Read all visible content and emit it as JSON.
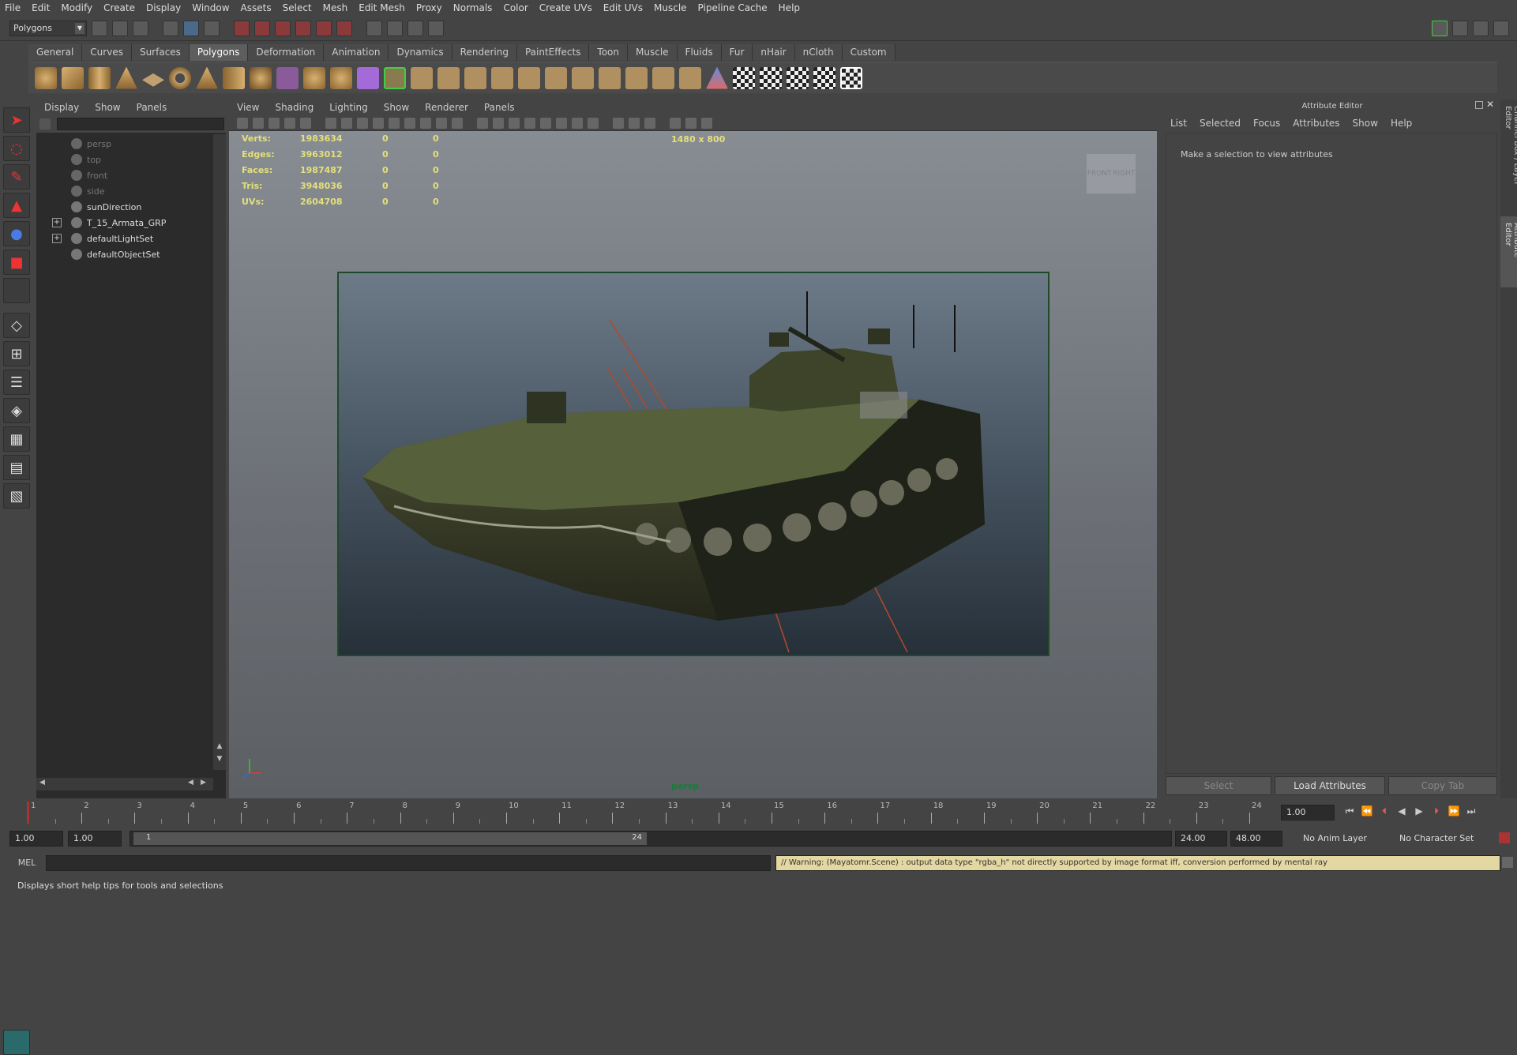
{
  "menubar": [
    "File",
    "Edit",
    "Modify",
    "Create",
    "Display",
    "Window",
    "Assets",
    "Select",
    "Mesh",
    "Edit Mesh",
    "Proxy",
    "Normals",
    "Color",
    "Create UVs",
    "Edit UVs",
    "Muscle",
    "Pipeline Cache",
    "Help"
  ],
  "status_line": {
    "mode_dropdown": "Polygons"
  },
  "shelf_tabs": [
    "General",
    "Curves",
    "Surfaces",
    "Polygons",
    "Deformation",
    "Animation",
    "Dynamics",
    "Rendering",
    "PaintEffects",
    "Toon",
    "Muscle",
    "Fluids",
    "Fur",
    "nHair",
    "nCloth",
    "Custom"
  ],
  "shelf_active": "Polygons",
  "outliner": {
    "menu": [
      "Display",
      "Show",
      "Panels"
    ],
    "items": [
      {
        "label": "persp",
        "dim": true,
        "expandable": false
      },
      {
        "label": "top",
        "dim": true,
        "expandable": false
      },
      {
        "label": "front",
        "dim": true,
        "expandable": false
      },
      {
        "label": "side",
        "dim": true,
        "expandable": false
      },
      {
        "label": "sunDirection",
        "dim": false,
        "expandable": false
      },
      {
        "label": "T_15_Armata_GRP",
        "dim": false,
        "expandable": true
      },
      {
        "label": "defaultLightSet",
        "dim": false,
        "expandable": true
      },
      {
        "label": "defaultObjectSet",
        "dim": false,
        "expandable": false
      }
    ]
  },
  "viewport": {
    "menu": [
      "View",
      "Shading",
      "Lighting",
      "Show",
      "Renderer",
      "Panels"
    ],
    "resolution": "1480 x 800",
    "camera": "persp",
    "viewcube_faces": [
      "FRONT",
      "RIGHT"
    ],
    "hud": [
      {
        "label": "Verts:",
        "v1": "1983634",
        "v2": "0",
        "v3": "0"
      },
      {
        "label": "Edges:",
        "v1": "3963012",
        "v2": "0",
        "v3": "0"
      },
      {
        "label": "Faces:",
        "v1": "1987487",
        "v2": "0",
        "v3": "0"
      },
      {
        "label": "Tris:",
        "v1": "3948036",
        "v2": "0",
        "v3": "0"
      },
      {
        "label": "UVs:",
        "v1": "2604708",
        "v2": "0",
        "v3": "0"
      }
    ]
  },
  "attribute_editor": {
    "title": "Attribute Editor",
    "menu": [
      "List",
      "Selected",
      "Focus",
      "Attributes",
      "Show",
      "Help"
    ],
    "message": "Make a selection to view attributes",
    "buttons": {
      "select": "Select",
      "load": "Load Attributes",
      "copy": "Copy Tab"
    },
    "side_tabs": [
      "Channel Box / Layer Editor",
      "Attribute Editor"
    ]
  },
  "timeline": {
    "ticks": [
      "1",
      "2",
      "3",
      "4",
      "5",
      "6",
      "7",
      "8",
      "9",
      "10",
      "11",
      "12",
      "13",
      "14",
      "15",
      "16",
      "17",
      "18",
      "19",
      "20",
      "21",
      "22",
      "23",
      "24"
    ],
    "current_frame": "1.00"
  },
  "range": {
    "start": "1.00",
    "anim_start": "1.00",
    "slider_start": "1",
    "slider_end": "24",
    "anim_end": "24.00",
    "end": "48.00",
    "anim_layer": "No Anim Layer",
    "character_set": "No Character Set"
  },
  "command_line": {
    "language": "MEL",
    "result": "// Warning: (Mayatomr.Scene) : output data type \"rgba_h\" not directly supported by image format iff, conversion performed by mental ray"
  },
  "help_line": "Displays short help tips for tools and selections"
}
